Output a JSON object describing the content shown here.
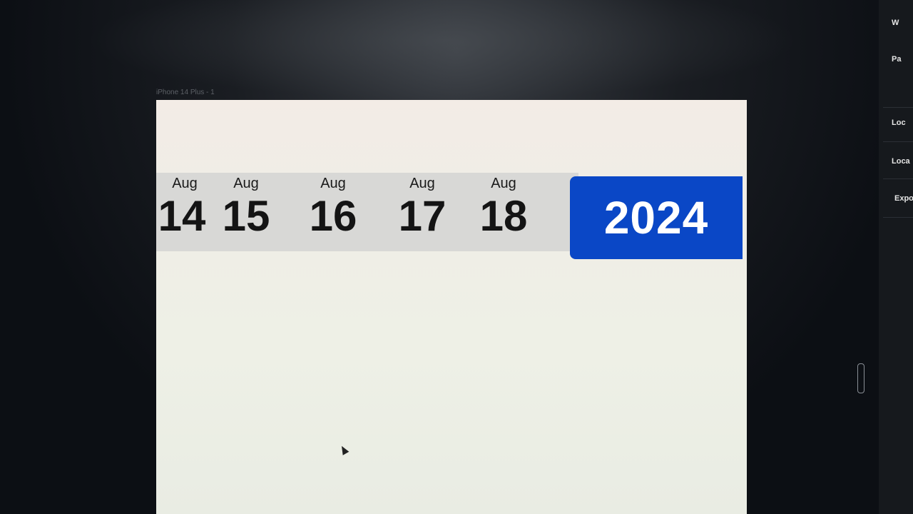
{
  "canvas": {
    "frame_label": "iPhone 14 Plus - 1"
  },
  "date_strip": {
    "dates": [
      {
        "month": "Aug",
        "day": "14"
      },
      {
        "month": "Aug",
        "day": "15"
      },
      {
        "month": "Aug",
        "day": "16"
      },
      {
        "month": "Aug",
        "day": "17"
      },
      {
        "month": "Aug",
        "day": "18"
      }
    ],
    "year": "2024"
  },
  "right_panel": {
    "items": [
      "W",
      "Pa",
      "Loc",
      "Loca",
      "Expo"
    ]
  },
  "colors": {
    "year_background": "#0a47c6",
    "strip_background": "#d8d8d6"
  }
}
